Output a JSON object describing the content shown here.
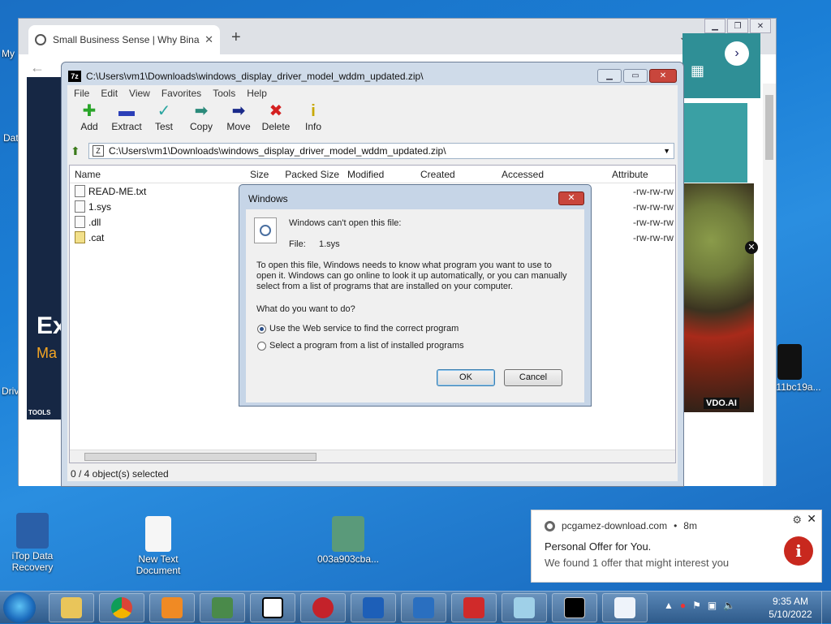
{
  "desktop": {
    "icons": [
      {
        "label": "iTop Data Recovery"
      },
      {
        "label": "New Text Document"
      },
      {
        "label": "003a903cba..."
      },
      {
        "label": "11bc19a..."
      }
    ],
    "edge_labels": [
      "My",
      "Dat",
      "Driv"
    ]
  },
  "chrome": {
    "tab_title": "Small Business Sense | Why Bina",
    "ad_left_big": "Ex",
    "ad_left_sub": "Ma",
    "ad_left_footer": "TOOLS",
    "ad_badge": "VDO.AI"
  },
  "sevenzip": {
    "title": "C:\\Users\\vm1\\Downloads\\windows_display_driver_model_wddm_updated.zip\\",
    "menu": [
      "File",
      "Edit",
      "View",
      "Favorites",
      "Tools",
      "Help"
    ],
    "toolbar": [
      {
        "label": "Add",
        "glyph": "✚",
        "color": "#2aa52a"
      },
      {
        "label": "Extract",
        "glyph": "▬",
        "color": "#2b3fb8"
      },
      {
        "label": "Test",
        "glyph": "✓",
        "color": "#2aa5a0"
      },
      {
        "label": "Copy",
        "glyph": "➡",
        "color": "#2a8a7a"
      },
      {
        "label": "Move",
        "glyph": "➡",
        "color": "#1a2a8a"
      },
      {
        "label": "Delete",
        "glyph": "✖",
        "color": "#d42020"
      },
      {
        "label": "Info",
        "glyph": "i",
        "color": "#c8a800"
      }
    ],
    "address": "C:\\Users\\vm1\\Downloads\\windows_display_driver_model_wddm_updated.zip\\",
    "columns": [
      "Name",
      "Size",
      "Packed Size",
      "Modified",
      "Created",
      "Accessed",
      "Attribute"
    ],
    "files": [
      {
        "name": "READ-ME.txt",
        "attr": "-rw-rw-rw"
      },
      {
        "name": "1.sys",
        "attr": "-rw-rw-rw"
      },
      {
        "name": ".dll",
        "attr": "-rw-rw-rw"
      },
      {
        "name": ".cat",
        "attr": "-rw-rw-rw"
      }
    ],
    "status": "0 / 4 object(s) selected"
  },
  "dialog": {
    "title": "Windows",
    "heading": "Windows can't open this file:",
    "file_label": "File:",
    "file_name": "1.sys",
    "para1": "To open this file, Windows needs to know what program you want to use to",
    "para2": "open it. Windows can go online to look it up automatically, or you can manually",
    "para3": "select from a list of programs that are installed on your computer.",
    "question": "What do you want to do?",
    "option1": "Use the Web service to find the correct program",
    "option2": "Select a program from a list of installed programs",
    "ok": "OK",
    "cancel": "Cancel"
  },
  "notification": {
    "source": "pcgamez-download.com",
    "age": "8m",
    "dot": "•",
    "title": "Personal Offer for You.",
    "message": "We found 1 offer that might interest you"
  },
  "taskbar": {
    "time": "9:35 AM",
    "date": "5/10/2022"
  }
}
